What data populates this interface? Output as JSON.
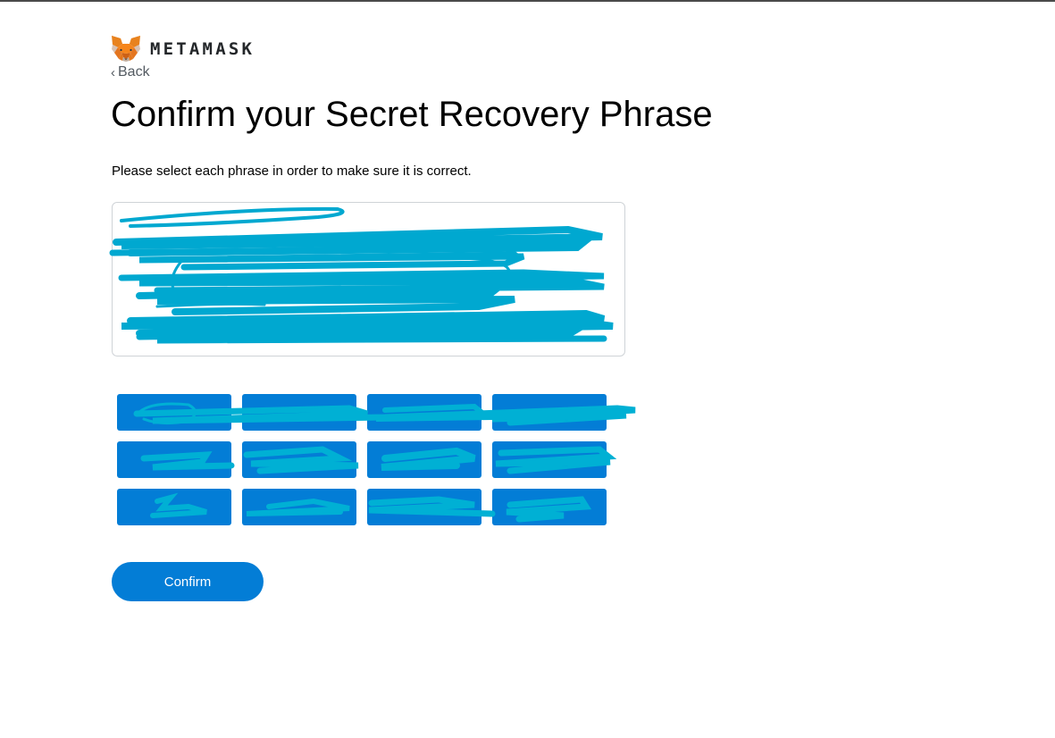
{
  "brand": {
    "name": "METAMASK",
    "logo_icon": "metamask-fox-icon"
  },
  "nav": {
    "back_label": "Back",
    "back_icon": "chevron-left-icon"
  },
  "page": {
    "title": "Confirm your Secret Recovery Phrase",
    "subtitle": "Please select each phrase in order to make sure it is correct."
  },
  "phrase_area": {
    "selected_words": []
  },
  "word_buttons": [
    "",
    "",
    "",
    "",
    "",
    "",
    "",
    "",
    "",
    "",
    "",
    ""
  ],
  "actions": {
    "confirm_label": "Confirm"
  },
  "colors": {
    "accent": "#037dd6",
    "redaction_scribble": "#00a8d0",
    "title_text": "#000000",
    "back_text": "#535a61",
    "wordmark": "#24272a"
  }
}
